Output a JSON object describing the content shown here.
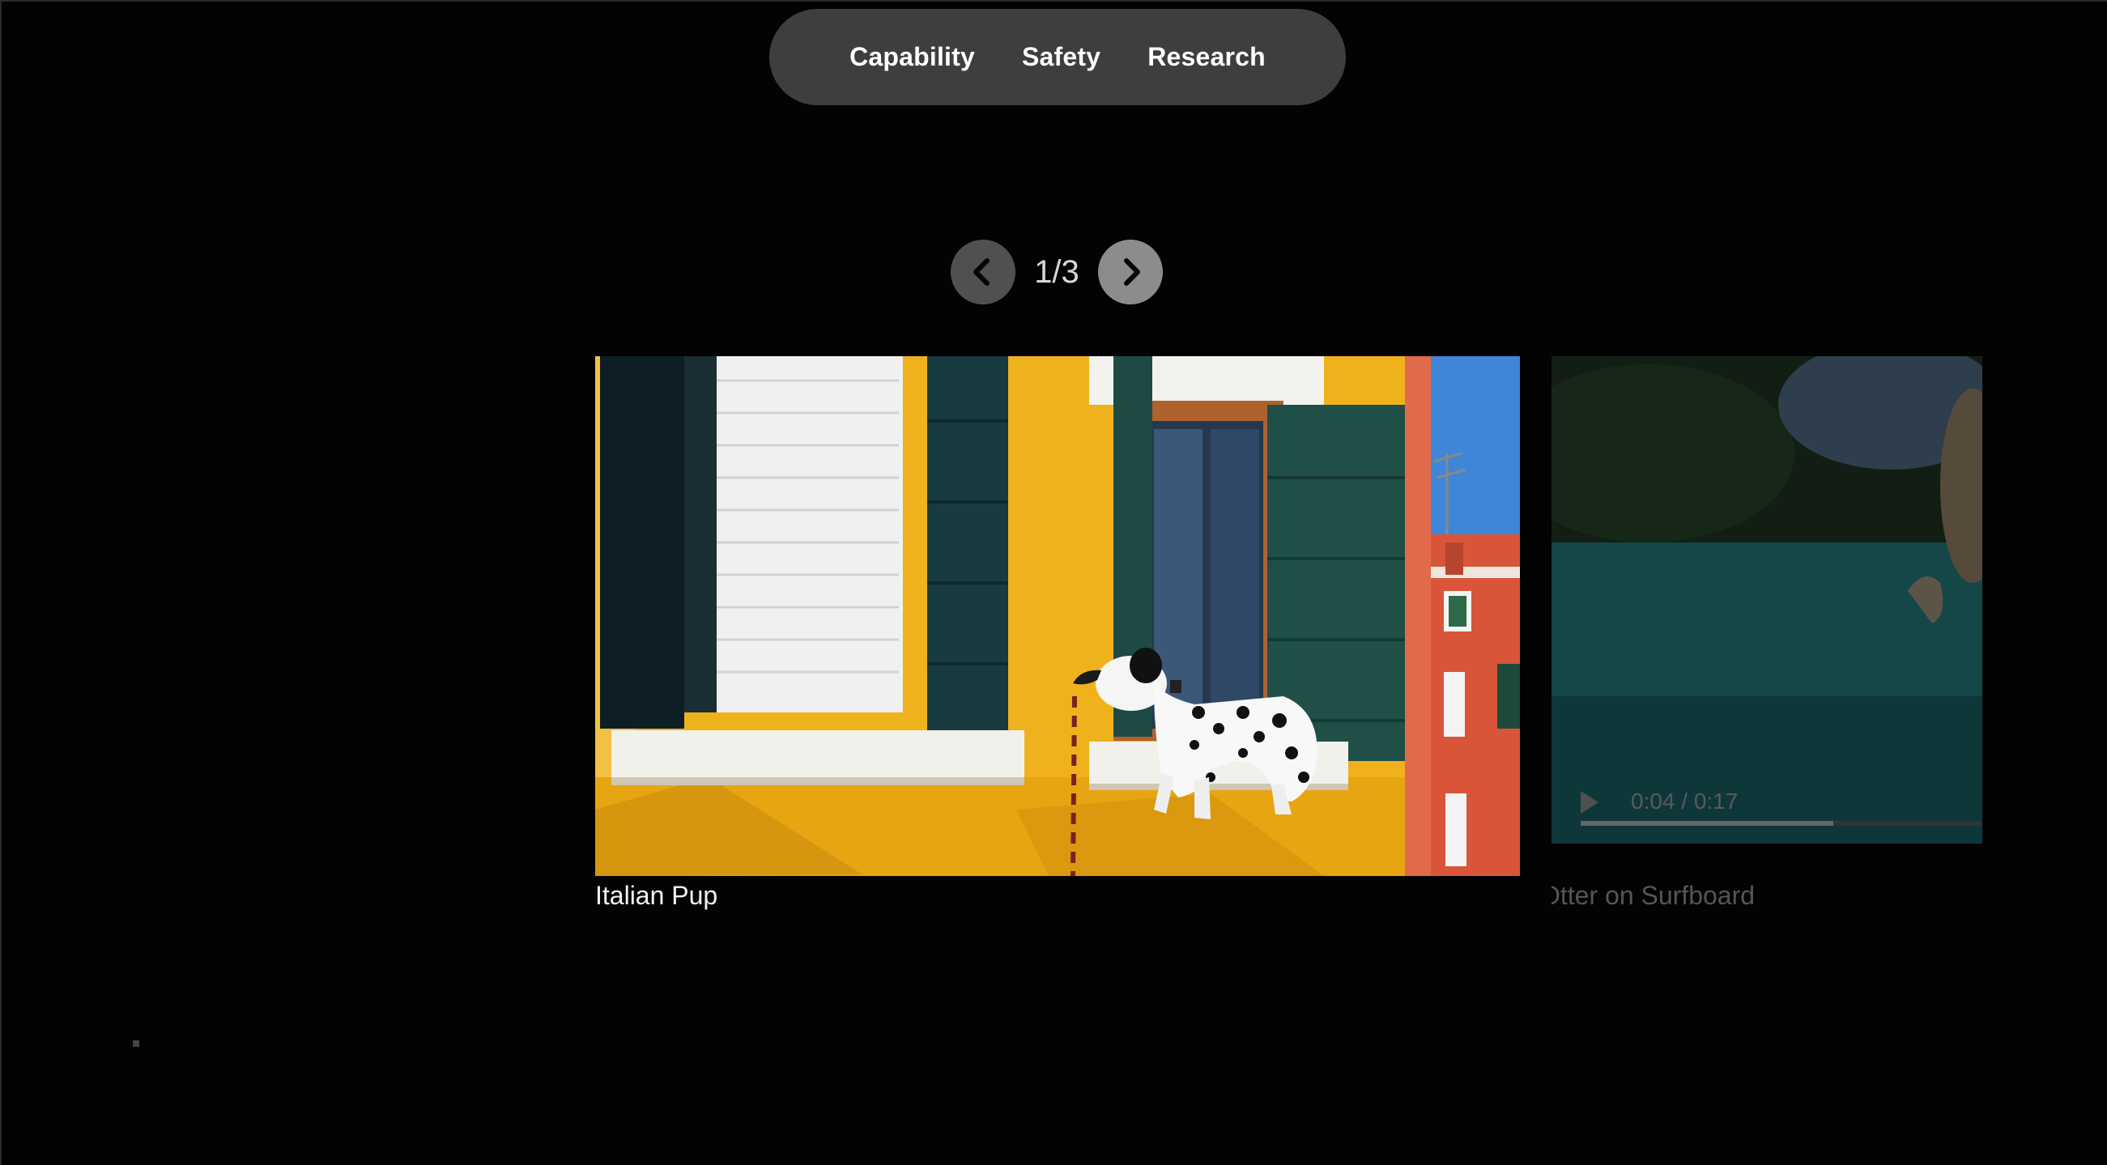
{
  "nav": {
    "items": [
      {
        "label": "Capability"
      },
      {
        "label": "Safety"
      },
      {
        "label": "Research"
      }
    ]
  },
  "pager": {
    "current": "1/3"
  },
  "cards": {
    "main": {
      "caption": "Italian Pup"
    },
    "side": {
      "caption": "Otter on Surfboard",
      "time": "0:04 / 0:17",
      "progress": 0.63
    }
  },
  "colors": {
    "background": "#030303",
    "nav_pill": "#3e3e3e",
    "wall_yellow": "#f2b41a",
    "shutter_green": "#17403f"
  }
}
